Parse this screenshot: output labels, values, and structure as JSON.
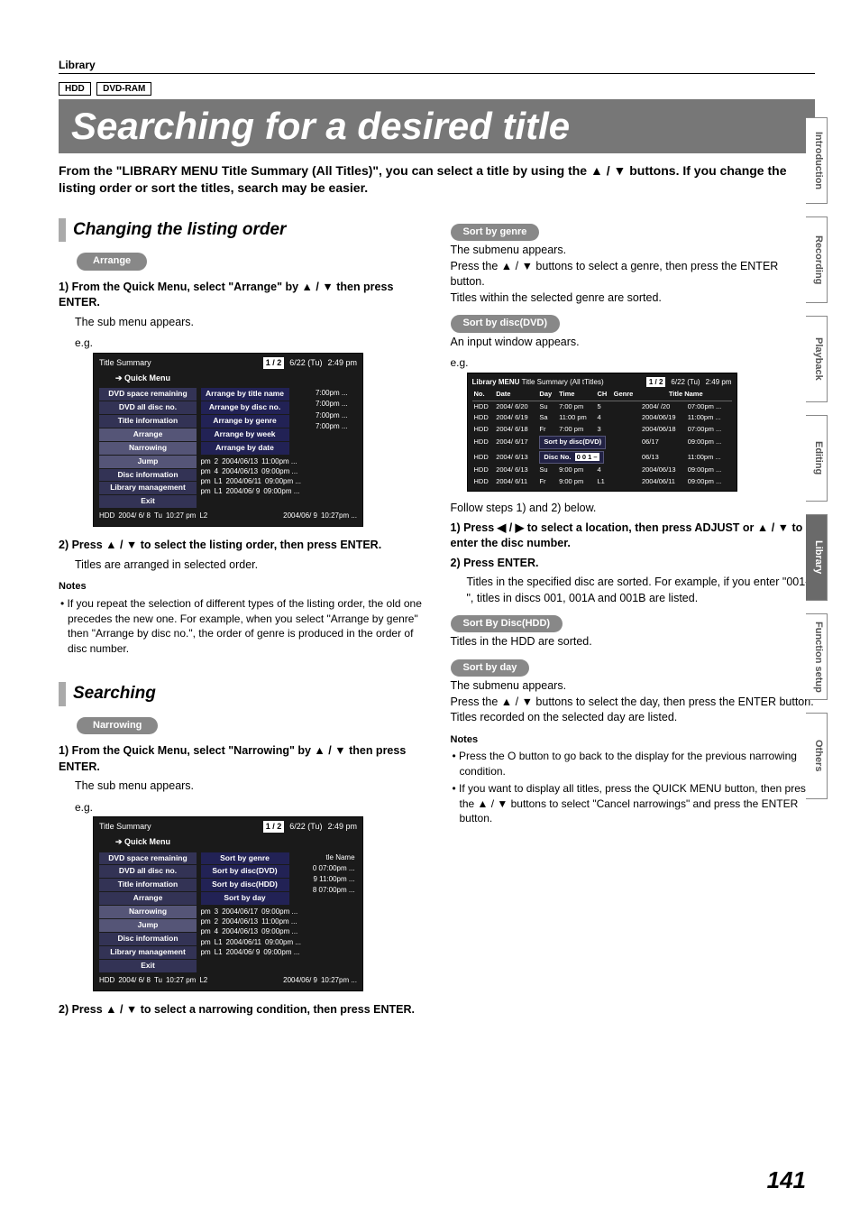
{
  "header": {
    "section": "Library",
    "media1": "HDD",
    "media2": "DVD-RAM"
  },
  "title": "Searching for a desired title",
  "intro": "From the \"LIBRARY MENU Title Summary (All Titles)\", you can select a title by using the ▲ / ▼ buttons. If you change the listing order or sort the titles, search may be easier.",
  "left": {
    "h2a": "Changing the listing order",
    "pillArrange": "Arrange",
    "step1": "1) From the Quick Menu, select \"Arrange\" by ▲ / ▼ then press ENTER.",
    "step1sub": "The sub menu appears.",
    "eg": "e.g.",
    "osd1": {
      "title": "Title Summary",
      "qmenu": "Quick Menu",
      "page": "1 / 2",
      "date": "6/22 (Tu)",
      "time": "2:49 pm",
      "menu": [
        "DVD space remaining",
        "DVD all disc no.",
        "Title information",
        "Arrange",
        "Narrowing",
        "Jump",
        "Disc information",
        "Library management",
        "Exit"
      ],
      "sub": [
        "Arrange by title name",
        "Arrange by disc no.",
        "Arrange by genre",
        "Arrange by week",
        "Arrange by date"
      ],
      "sidevals": [
        "7:00pm ...",
        "7:00pm ...",
        "7:00pm ...",
        "7:00pm ..."
      ],
      "rows": [
        [
          "pm",
          "2",
          "",
          "2004/06/13",
          "11:00pm ..."
        ],
        [
          "pm",
          "4",
          "",
          "2004/06/13",
          "09:00pm ..."
        ],
        [
          "pm",
          "L1",
          "",
          "2004/06/11",
          "09:00pm ..."
        ],
        [
          "pm",
          "L1",
          "",
          "2004/06/ 9",
          "09:00pm ..."
        ]
      ],
      "footer": [
        "HDD",
        "2004/ 6/ 8",
        "Tu",
        "10:27 pm",
        "L2",
        "",
        "2004/06/ 9",
        "10:27pm ..."
      ]
    },
    "step2": "2) Press ▲ / ▼ to select the listing order, then press ENTER.",
    "step2sub": "Titles are arranged in selected order.",
    "notesH": "Notes",
    "note1": "• If you repeat the selection of different types of the listing order, the old one precedes the new one. For example, when you select \"Arrange by genre\" then \"Arrange by disc no.\", the order of genre is produced in the order of disc number.",
    "h2b": "Searching",
    "pillNarrow": "Narrowing",
    "nstep1": "1) From the Quick Menu, select \"Narrowing\" by ▲ / ▼ then press ENTER.",
    "nstep1sub": "The sub menu appears.",
    "osd2": {
      "title": "Title Summary",
      "qmenu": "Quick Menu",
      "page": "1 / 2",
      "date": "6/22 (Tu)",
      "time": "2:49 pm",
      "menu": [
        "DVD space remaining",
        "DVD all disc no.",
        "Title information",
        "Arrange",
        "Narrowing",
        "Jump",
        "Disc information",
        "Library management",
        "Exit"
      ],
      "sub": [
        "Sort by genre",
        "Sort by disc(DVD)",
        "Sort by disc(HDD)",
        "Sort by day"
      ],
      "sidevals": [
        "tle Name",
        "0  07:00pm ...",
        "9  11:00pm ...",
        "8  07:00pm ..."
      ],
      "rows": [
        [
          "pm",
          "3",
          "",
          "2004/06/17",
          "09:00pm ..."
        ],
        [
          "pm",
          "2",
          "",
          "2004/06/13",
          "11:00pm ..."
        ],
        [
          "pm",
          "4",
          "",
          "2004/06/13",
          "09:00pm ..."
        ],
        [
          "pm",
          "L1",
          "",
          "2004/06/11",
          "09:00pm ..."
        ],
        [
          "pm",
          "L1",
          "",
          "2004/06/ 9",
          "09:00pm ..."
        ]
      ],
      "footer": [
        "HDD",
        "2004/ 6/ 8",
        "Tu",
        "10:27 pm",
        "L2",
        "",
        "2004/06/ 9",
        "10:27pm ..."
      ]
    },
    "nstep2": "2) Press ▲ / ▼ to select a narrowing condition, then press ENTER."
  },
  "right": {
    "p_genre": "Sort by genre",
    "genre1": "The submenu appears.",
    "genre2": "Press the ▲ / ▼ buttons to select a genre, then press the ENTER button.",
    "genre3": "Titles within the selected genre are sorted.",
    "p_dvd": "Sort by disc(DVD)",
    "dvd1": "An input window appears.",
    "eg": "e.g.",
    "osd3": {
      "lib": "Library MENU",
      "sub": "Title Summary (All tTitles)",
      "page": "1 / 2",
      "date": "6/22 (Tu)",
      "time": "2:49 pm",
      "head": [
        "No.",
        "Date",
        "Day",
        "Time",
        "CH",
        "Genre",
        "Title Name"
      ],
      "rows": [
        [
          "HDD",
          "2004/ 6/20",
          "Su",
          "7:00 pm",
          "5",
          "",
          "2004/   /20",
          "07:00pm ..."
        ],
        [
          "HDD",
          "2004/ 6/19",
          "Sa",
          "11:00 pm",
          "4",
          "",
          "2004/06/19",
          "11:00pm ..."
        ],
        [
          "HDD",
          "2004/ 6/18",
          "Fr",
          "7:00 pm",
          "3",
          "",
          "2004/06/18",
          "07:00pm ..."
        ],
        [
          "HDD",
          "2004/ 6/17",
          "",
          "Sort by disc(DVD)",
          "",
          "",
          "06/17",
          "09:00pm ..."
        ],
        [
          "HDD",
          "2004/ 6/13",
          "",
          "Disc No.",
          "0 0 1 –",
          "",
          "06/13",
          "11:00pm ..."
        ],
        [
          "HDD",
          "2004/ 6/13",
          "Su",
          "9:00 pm",
          "4",
          "",
          "2004/06/13",
          "09:00pm ..."
        ],
        [
          "HDD",
          "2004/ 6/11",
          "Fr",
          "9:00 pm",
          "L1",
          "",
          "2004/06/11",
          "09:00pm ..."
        ]
      ],
      "popupLabel": "Sort by disc(DVD)",
      "popupDisc": "Disc No.",
      "popupNum": "0 0 1 –"
    },
    "dvd_follow": "Follow steps 1) and 2) below.",
    "dvd_s1": "1) Press ◀ / ▶ to select a location, then press ADJUST or ▲ / ▼ to enter the disc number.",
    "dvd_s2": "2) Press ENTER.",
    "dvd_s2b": "Titles in the specified disc are sorted. For example, if you enter \"001-\", titles in discs 001, 001A and 001B are listed.",
    "p_hdd": "Sort By Disc(HDD)",
    "hdd1": "Titles in the HDD are sorted.",
    "p_day": "Sort by day",
    "day1": "The submenu appears.",
    "day2": "Press the ▲ / ▼ buttons to select the day, then press the ENTER button.",
    "day3": "Titles recorded on the selected day are listed.",
    "notesH": "Notes",
    "rn1": "• Press the O button to go back to the display for the previous narrowing condition.",
    "rn2": "• If you want to display all titles, press the QUICK MENU button, then press the ▲ / ▼ buttons to select \"Cancel narrowings\" and press the ENTER button."
  },
  "tabs": [
    "Introduction",
    "Recording",
    "Playback",
    "Editing",
    "Library",
    "Function setup",
    "Others"
  ],
  "activeTab": "Library",
  "pagenum": "141"
}
